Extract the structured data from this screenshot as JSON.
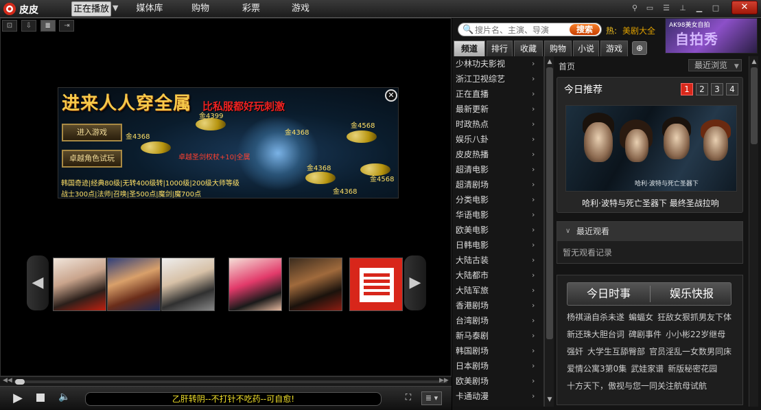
{
  "app": {
    "name": "皮皮"
  },
  "topmenu": [
    {
      "label": "正在播放",
      "active": true
    },
    {
      "label": "媒体库"
    },
    {
      "label": "购物"
    },
    {
      "label": "彩票"
    },
    {
      "label": "游戏"
    }
  ],
  "window": {
    "close_label": "✕"
  },
  "ad": {
    "headline": "进来人人穿全属",
    "sub": "比私服都好玩刺激",
    "button_enter": "进入游戏",
    "button_trial": "卓越角色试玩",
    "gold": [
      "金4399",
      "金4368",
      "金4568",
      "金4368",
      "金4368",
      "金4368",
      "金4568"
    ],
    "red_text": "卓越圣剑权杖+10|全属",
    "bottom1": "韩国奇迹|经典80级|无转400级转|1000级|200级大师等级",
    "bottom2": "战士300点|法师|召唤|圣500点|魔剑|魔700点"
  },
  "player": {
    "now_playing": "乙肝转阴--不打针不吃药--可自愈!"
  },
  "search": {
    "placeholder": "搜片名、主演、导演",
    "button": "搜索",
    "hot_label": "热:",
    "hot_text": "美剧大全"
  },
  "brand_ad": {
    "tag": "AK98美女自拍",
    "big": "自拍秀"
  },
  "tabs": [
    {
      "label": "频道",
      "active": true
    },
    {
      "label": "排行"
    },
    {
      "label": "收藏"
    },
    {
      "label": "购物"
    },
    {
      "label": "小说"
    },
    {
      "label": "游戏"
    }
  ],
  "channels": [
    "少林功夫影视",
    "浙江卫视综艺",
    "正在直播",
    "最新更新",
    "时政热点",
    "娱乐八卦",
    "皮皮热播",
    "超清电影",
    "超清剧场",
    "分类电影",
    "华语电影",
    "欧美电影",
    "日韩电影",
    "大陆古装",
    "大陆都市",
    "大陆军旅",
    "香港剧场",
    "台湾剧场",
    "新马泰剧",
    "韩国剧场",
    "日本剧场",
    "欧美剧场",
    "卡通动漫"
  ],
  "content": {
    "home": "首页",
    "recent_dropdown": "最近浏览",
    "today_title": "今日推荐",
    "pages": [
      "1",
      "2",
      "3",
      "4"
    ],
    "poster_caption": "哈利·波特与死亡圣器下",
    "poster_title": "哈利·波特与死亡圣器下 最终圣战拉响",
    "recent_title": "最近观看",
    "recent_empty": "暂无观看记录",
    "news_tabs": [
      "今日时事",
      "娱乐快报"
    ],
    "news": [
      [
        "杨祺涵自杀未遂",
        "蝙蝠女",
        "狂敌女狠抓男友下体"
      ],
      [
        "新还珠大胆台词",
        "碑剧事件",
        "小小彬22岁继母"
      ],
      [
        "强奸",
        "大学生互舔臀部",
        "官员淫乱一女数男同床"
      ],
      [
        "爱情公寓3第0集",
        "武娃家谱",
        "新版秘密花园"
      ],
      [
        "十方天下，傲视与您一同关注航母试航"
      ]
    ]
  }
}
